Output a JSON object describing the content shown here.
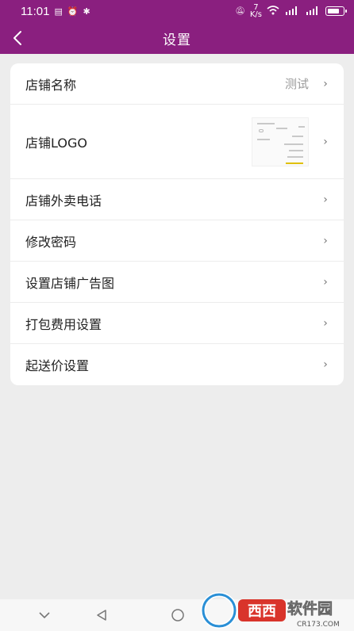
{
  "status_bar": {
    "time": "11:01",
    "net_speed_top": "7",
    "net_speed_unit": "K/s"
  },
  "header": {
    "title": "设置"
  },
  "settings": {
    "items": [
      {
        "label": "店铺名称",
        "value": "测试"
      },
      {
        "label": "店铺LOGO"
      },
      {
        "label": "店铺外卖电话"
      },
      {
        "label": "修改密码"
      },
      {
        "label": "设置店铺广告图"
      },
      {
        "label": "打包费用设置"
      },
      {
        "label": "起送价设置"
      }
    ],
    "chevron": "›"
  },
  "watermark": {
    "text": "西西软件园",
    "url": "CR173.COM"
  },
  "colors": {
    "primary": "#8a1f7f",
    "background": "#ededed",
    "card": "#ffffff"
  },
  "icons": [
    "back-arrow-icon",
    "chevron-right-icon",
    "nav-down-icon",
    "nav-back-icon",
    "nav-home-icon"
  ]
}
